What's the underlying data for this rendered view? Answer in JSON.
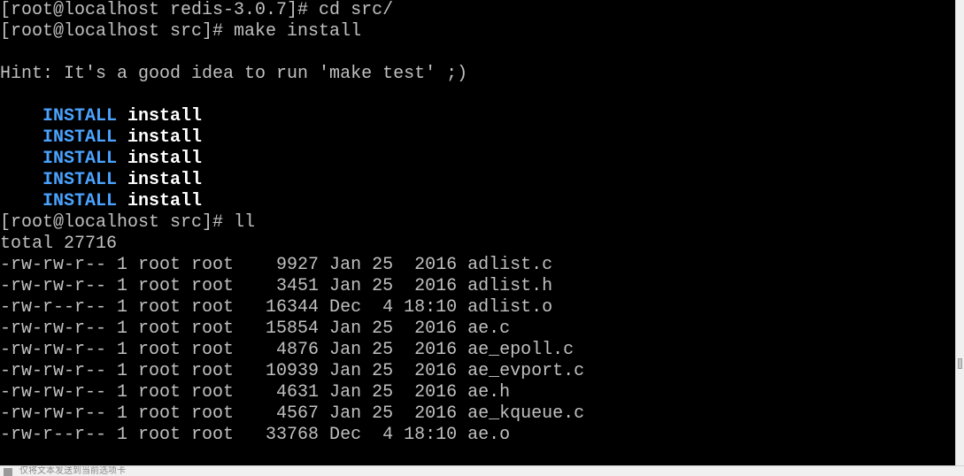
{
  "terminal": {
    "lines": [
      "[root@localhost redis-3.0.7]# cd src/",
      "[root@localhost src]# make install",
      "",
      "Hint: It's a good idea to run 'make test' ;)",
      ""
    ],
    "install_block": {
      "indent": "    ",
      "keyword": "INSTALL",
      "target": "install",
      "keyword_color": "#4aa3ff",
      "target_color": "#ffffff",
      "count": 5
    },
    "after_lines": [
      "[root@localhost src]# ll",
      "total 27716",
      "-rw-rw-r-- 1 root root    9927 Jan 25  2016 adlist.c",
      "-rw-rw-r-- 1 root root    3451 Jan 25  2016 adlist.h",
      "-rw-r--r-- 1 root root   16344 Dec  4 18:10 adlist.o",
      "-rw-rw-r-- 1 root root   15854 Jan 25  2016 ae.c",
      "-rw-rw-r-- 1 root root    4876 Jan 25  2016 ae_epoll.c",
      "-rw-rw-r-- 1 root root   10939 Jan 25  2016 ae_evport.c",
      "-rw-rw-r-- 1 root root    4631 Jan 25  2016 ae.h",
      "-rw-rw-r-- 1 root root    4567 Jan 25  2016 ae_kqueue.c",
      "-rw-r--r-- 1 root root   33768 Dec  4 18:10 ae.o"
    ],
    "background_color": "#000000",
    "text_color": "#c0c0c0"
  },
  "status_bar": {
    "text": "仅将文本发送到当前选项卡"
  }
}
